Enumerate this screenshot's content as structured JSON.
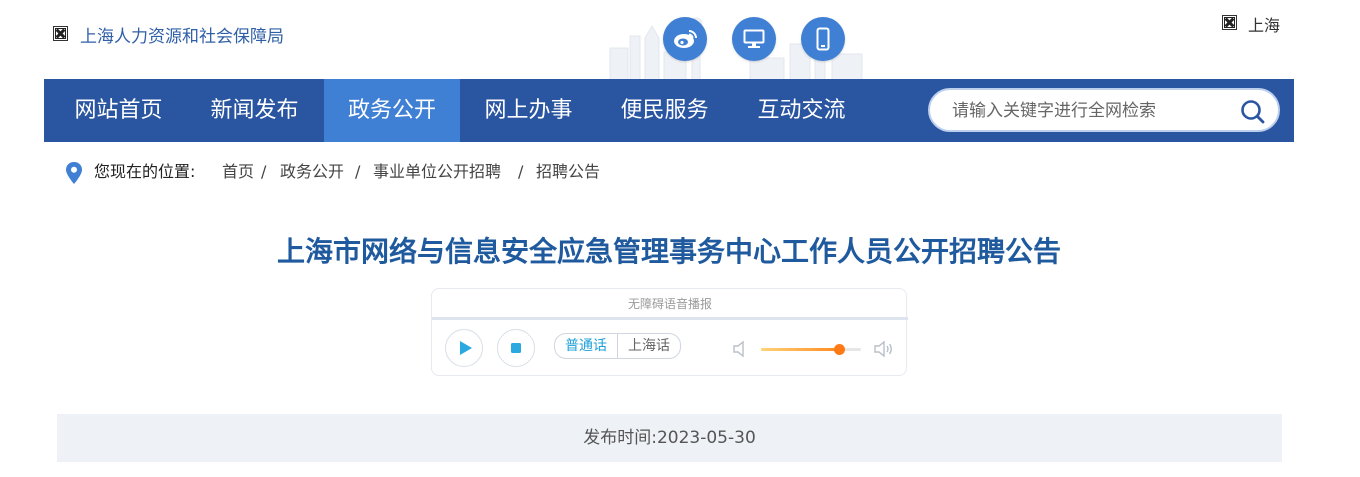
{
  "header": {
    "site_name": "上海人力资源和社会保障局",
    "region": "上海",
    "icons": [
      "weibo-icon",
      "monitor-icon",
      "mobile-icon"
    ]
  },
  "nav": {
    "items": [
      {
        "label": "网站首页",
        "active": false
      },
      {
        "label": "新闻发布",
        "active": false
      },
      {
        "label": "政务公开",
        "active": true
      },
      {
        "label": "网上办事",
        "active": false
      },
      {
        "label": "便民服务",
        "active": false
      },
      {
        "label": "互动交流",
        "active": false
      }
    ],
    "search_placeholder": "请输入关键字进行全网检索"
  },
  "breadcrumb": {
    "label": "您现在的位置:",
    "items": [
      "首页",
      "政务公开",
      "事业单位公开招聘",
      "招聘公告"
    ],
    "separator": "/"
  },
  "article": {
    "title": "上海市网络与信息安全应急管理事务中心工作人员公开招聘公告",
    "publish": "发布时间:2023-05-30"
  },
  "player": {
    "label": "无障碍语音播报",
    "languages": [
      "普通话",
      "上海话"
    ],
    "selected_language": "普通话",
    "volume": 0.78
  },
  "colors": {
    "nav_bg": "#2a55a0",
    "nav_active": "#3f7fd4",
    "title": "#1f5a9e",
    "accent_player": "#1fa0d8",
    "volume": "#ff7a14"
  }
}
